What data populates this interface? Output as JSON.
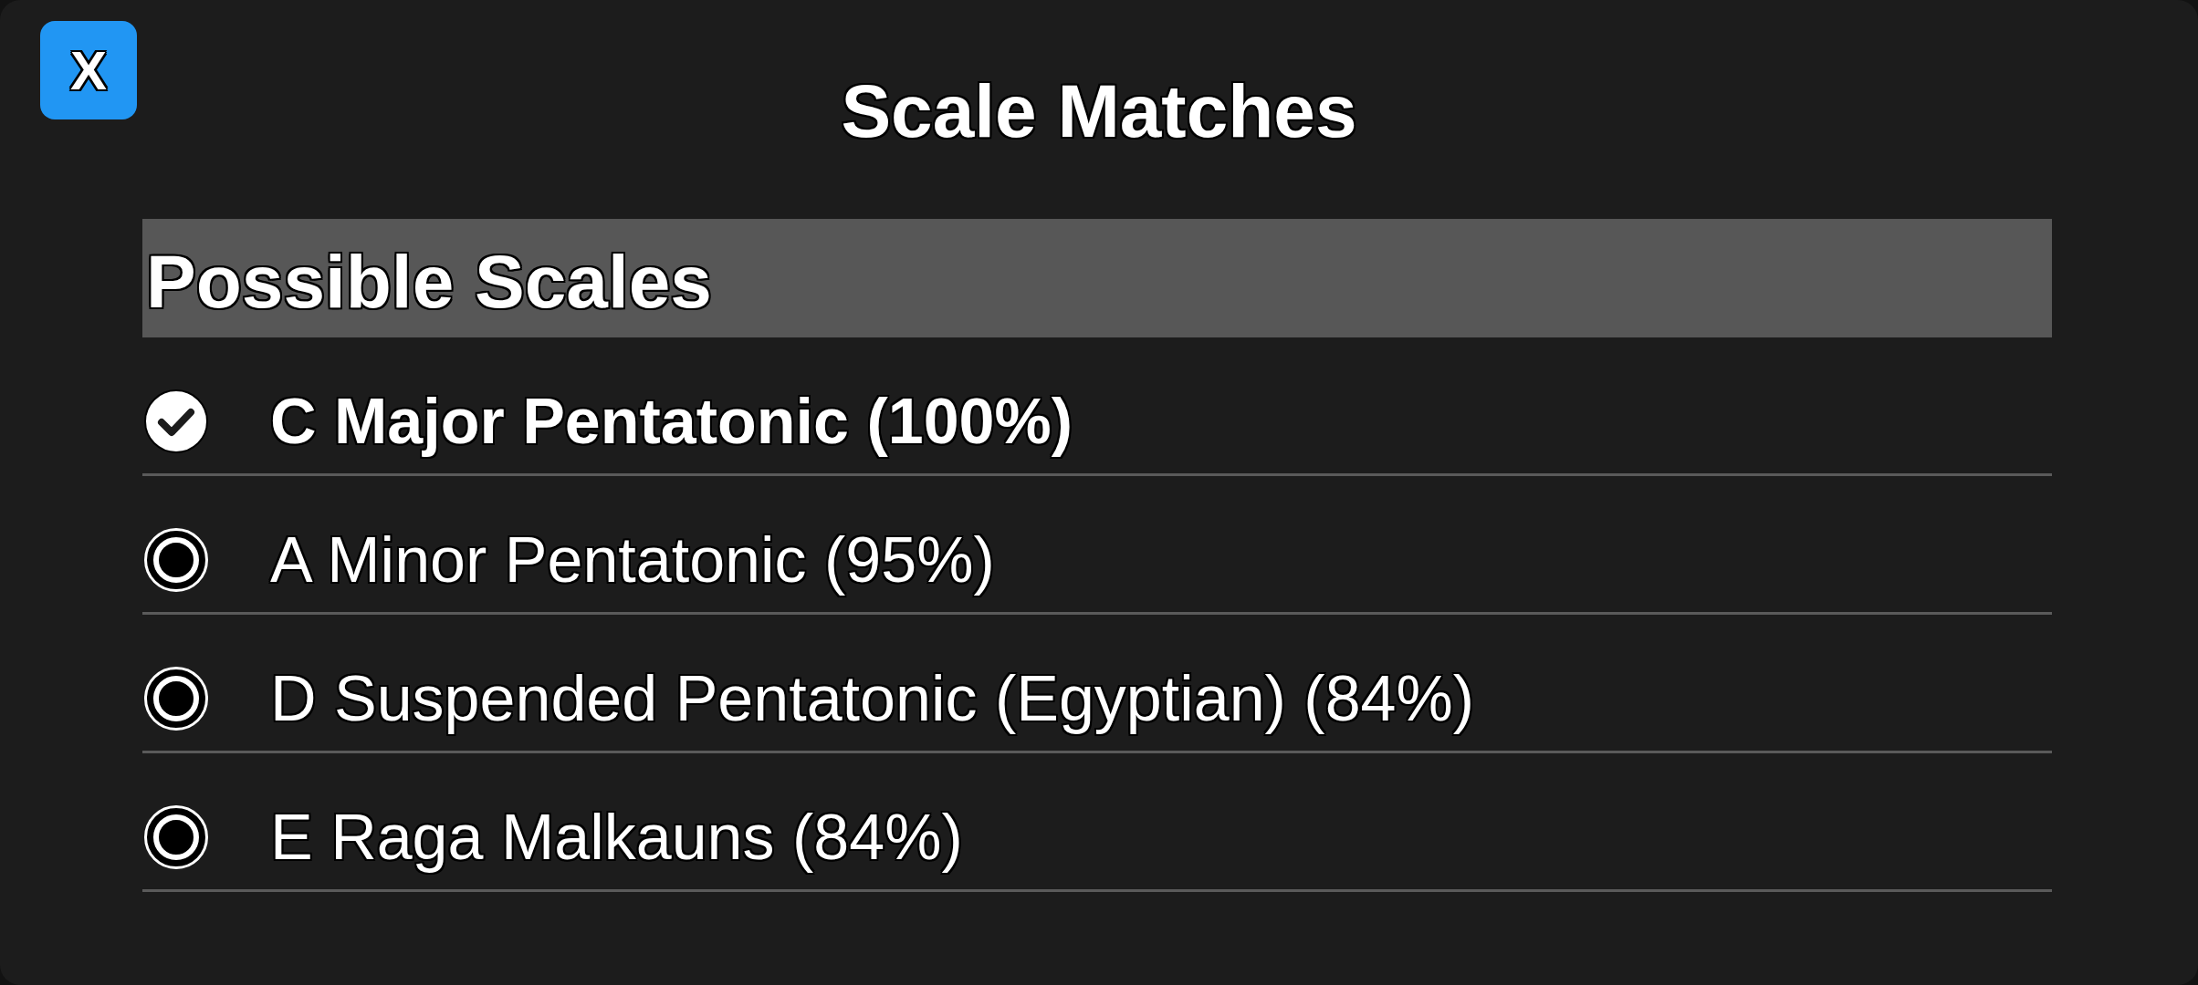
{
  "close_button": {
    "label": "X"
  },
  "title": "Scale Matches",
  "scale_list": {
    "header": "Possible Scales",
    "items": [
      {
        "label": "C Major Pentatonic (100%)",
        "selected": true
      },
      {
        "label": "A Minor Pentatonic (95%)",
        "selected": false
      },
      {
        "label": "D Suspended Pentatonic (Egyptian) (84%)",
        "selected": false
      },
      {
        "label": "E Raga Malkauns (84%)",
        "selected": false
      }
    ]
  }
}
